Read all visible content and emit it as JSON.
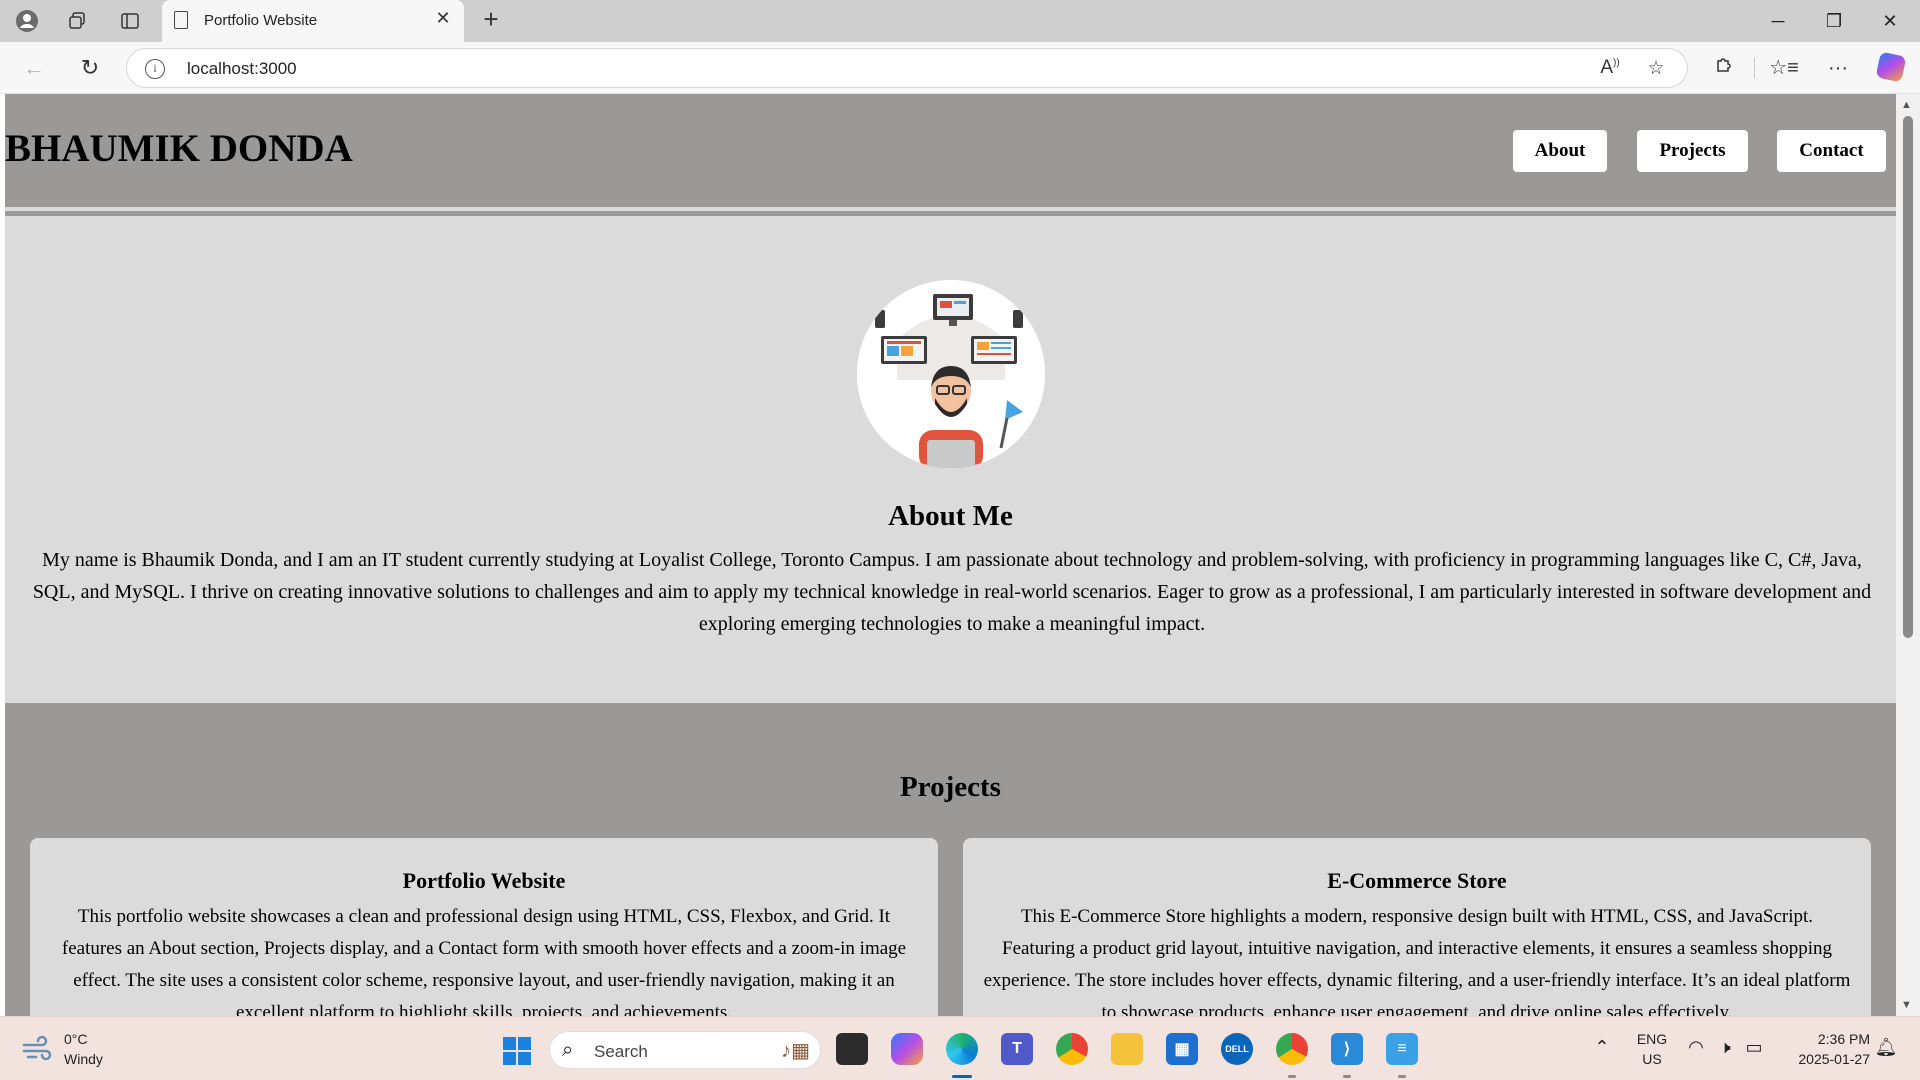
{
  "browser": {
    "tab_title": "Portfolio Website",
    "url": "localhost:3000"
  },
  "site": {
    "title": "BHAUMIK DONDA",
    "nav": [
      "About",
      "Projects",
      "Contact"
    ]
  },
  "about": {
    "heading": "About Me",
    "text": "My name is Bhaumik Donda, and I am an IT student currently studying at Loyalist College, Toronto Campus. I am passionate about technology and problem-solving, with proficiency in programming languages like C, C#, Java, SQL, and MySQL. I thrive on creating innovative solutions to challenges and aim to apply my technical knowledge in real-world scenarios. Eager to grow as a professional, I am particularly interested in software development and exploring emerging technologies to make a meaningful impact."
  },
  "projects": {
    "heading": "Projects",
    "items": [
      {
        "title": "Portfolio Website",
        "description": "This portfolio website showcases a clean and professional design using HTML, CSS, Flexbox, and Grid. It features an About section, Projects display, and a Contact form with smooth hover effects and a zoom-in image effect. The site uses a consistent color scheme, responsive layout, and user-friendly navigation, making it an excellent platform to highlight skills, projects, and achievements."
      },
      {
        "title": "E-Commerce Store",
        "description": "This E-Commerce Store highlights a modern, responsive design built with HTML, CSS, and JavaScript. Featuring a product grid layout, intuitive navigation, and interactive elements, it ensures a seamless shopping experience. The store includes hover effects, dynamic filtering, and a user-friendly interface. It’s an ideal platform to showcase products, enhance user engagement, and drive online sales effectively."
      }
    ]
  },
  "taskbar": {
    "weather_temp": "0°C",
    "weather_condition": "Windy",
    "search_label": "Search",
    "lang_top": "ENG",
    "lang_bottom": "US",
    "time": "2:36 PM",
    "date": "2025-01-27"
  },
  "colors": {
    "header_bg": "#9a9998",
    "section_bg": "#dcdbdc",
    "taskbar_bg": "#f3e3de",
    "accent": "#0067c0"
  }
}
